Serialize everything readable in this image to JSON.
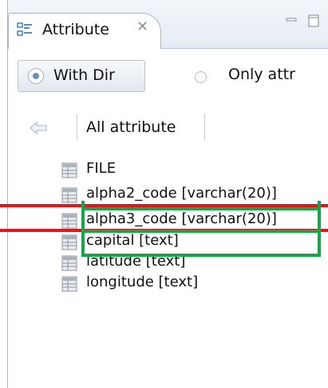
{
  "panel": {
    "title": "Attribute",
    "close_glyph": "✕"
  },
  "toolbar": {
    "option_with_dir": "With Dir",
    "option_only_attr": "Only attr",
    "selected": "With Dir"
  },
  "breadcrumb": {
    "label": "All attribute"
  },
  "tree": {
    "items": [
      {
        "label": "FILE"
      },
      {
        "label": "alpha2_code [varchar(20)]"
      },
      {
        "label": "alpha3_code [varchar(20)]"
      },
      {
        "label": "capital [text]"
      },
      {
        "label": "latitude [text]"
      },
      {
        "label": "longitude [text]"
      }
    ]
  },
  "colors": {
    "annotation_red": "#e5161a",
    "annotation_green": "#18a44a",
    "tab_border": "#a9b6c8"
  },
  "icons": {
    "tab": "attribute-view-icon",
    "item": "column-table-icon",
    "back": "back-arrow-icon"
  }
}
